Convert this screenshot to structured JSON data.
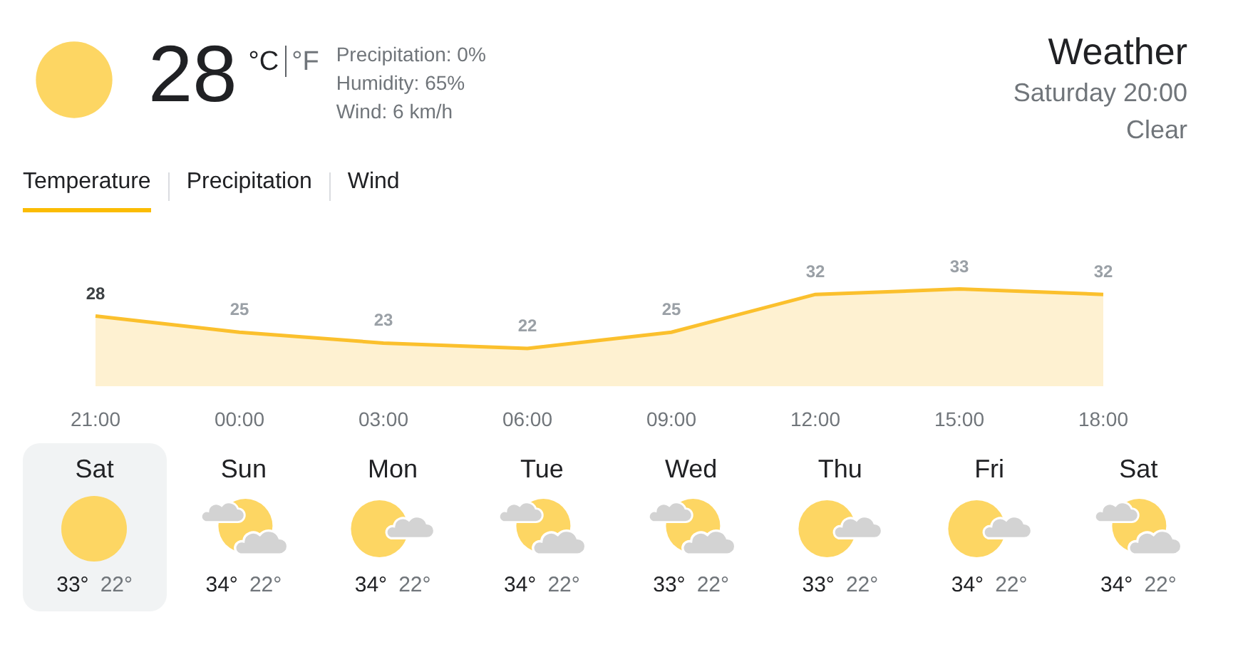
{
  "current": {
    "kind": "sunny",
    "temperature": "28",
    "units": [
      {
        "label": "°C",
        "selected": true
      },
      {
        "label": "°F",
        "selected": false
      }
    ],
    "details": [
      "Precipitation: 0%",
      "Humidity: 65%",
      "Wind: 6 km/h"
    ]
  },
  "header": {
    "title": "Weather",
    "time": "Saturday 20:00",
    "condition": "Clear"
  },
  "tabs": [
    {
      "label": "Temperature",
      "selected": true
    },
    {
      "label": "Precipitation",
      "selected": false
    },
    {
      "label": "Wind",
      "selected": false
    }
  ],
  "chart": {
    "chart_data": {
      "type": "area",
      "categories": [
        "21:00",
        "00:00",
        "03:00",
        "06:00",
        "09:00",
        "12:00",
        "15:00",
        "18:00"
      ],
      "series": [
        {
          "color": "#fbc02d",
          "values": [
            28,
            25,
            23,
            22,
            25,
            32,
            33,
            32
          ]
        }
      ],
      "data_labels": true
    }
  },
  "days": [
    {
      "day": "Sat",
      "kind": "sunny",
      "high": "33°",
      "low": "22°",
      "selected": true
    },
    {
      "day": "Sun",
      "kind": "mostly_cloudy",
      "high": "34°",
      "low": "22°",
      "selected": false
    },
    {
      "day": "Mon",
      "kind": "partly_cloudy",
      "high": "34°",
      "low": "22°",
      "selected": false
    },
    {
      "day": "Tue",
      "kind": "mostly_cloudy",
      "high": "34°",
      "low": "22°",
      "selected": false
    },
    {
      "day": "Wed",
      "kind": "mostly_cloudy",
      "high": "33°",
      "low": "22°",
      "selected": false
    },
    {
      "day": "Thu",
      "kind": "partly_cloudy",
      "high": "33°",
      "low": "22°",
      "selected": false
    },
    {
      "day": "Fri",
      "kind": "partly_cloudy",
      "high": "34°",
      "low": "22°",
      "selected": false
    },
    {
      "day": "Sat",
      "kind": "mostly_cloudy",
      "high": "34°",
      "low": "22°",
      "selected": false
    }
  ]
}
